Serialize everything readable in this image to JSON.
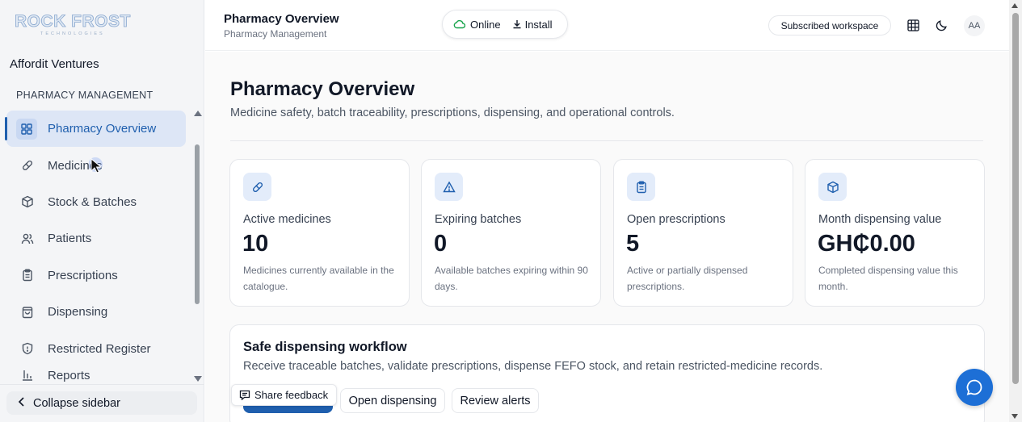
{
  "brand": {
    "logo_text": "ROCK FROST",
    "logo_sub": "TECHNOLOGIES"
  },
  "sidebar": {
    "workspace": "Affordit Ventures",
    "section": "PHARMACY MANAGEMENT",
    "items": [
      {
        "label": "Pharmacy Overview",
        "icon": "grid-icon",
        "active": true
      },
      {
        "label": "Medicines",
        "icon": "pill-icon"
      },
      {
        "label": "Stock & Batches",
        "icon": "package-icon"
      },
      {
        "label": "Patients",
        "icon": "users-icon"
      },
      {
        "label": "Prescriptions",
        "icon": "clipboard-icon"
      },
      {
        "label": "Dispensing",
        "icon": "bag-icon"
      },
      {
        "label": "Restricted Register",
        "icon": "shield-icon"
      },
      {
        "label": "Reports",
        "icon": "chart-icon"
      }
    ],
    "collapse_label": "Collapse sidebar"
  },
  "header": {
    "title": "Pharmacy Overview",
    "subtitle": "Pharmacy Management",
    "status": "Online",
    "install": "Install",
    "subscription": "Subscribed workspace",
    "avatar": "AA"
  },
  "main": {
    "title": "Pharmacy Overview",
    "subtitle": "Medicine safety, batch traceability, prescriptions, dispensing, and operational controls.",
    "cards": [
      {
        "label": "Active medicines",
        "value": "10",
        "desc": "Medicines currently available in the catalogue.",
        "icon": "pill-icon"
      },
      {
        "label": "Expiring batches",
        "value": "0",
        "desc": "Available batches expiring within 90 days.",
        "icon": "alert-triangle-icon"
      },
      {
        "label": "Open prescriptions",
        "value": "5",
        "desc": "Active or partially dispensed prescriptions.",
        "icon": "clipboard-icon"
      },
      {
        "label": "Month dispensing value",
        "value": "GH₵0.00",
        "desc": "Completed dispensing value this month.",
        "icon": "box-icon"
      }
    ],
    "workflow": {
      "title": "Safe dispensing workflow",
      "desc": "Receive traceable batches, validate prescriptions, dispense FEFO stock, and retain restricted-medicine records.",
      "open_dispensing": "Open dispensing",
      "review_alerts": "Review alerts"
    },
    "share_feedback": "Share feedback"
  },
  "colors": {
    "accent": "#1f5fae",
    "active_bg": "#dde6f6",
    "online": "#16a34a",
    "fab": "#1d6fd6"
  }
}
